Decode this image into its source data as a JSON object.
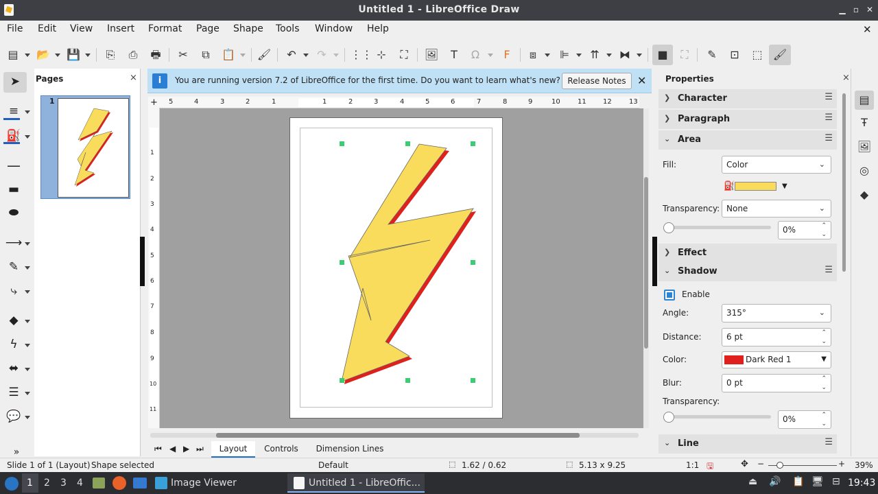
{
  "window": {
    "title": "Untitled 1 - LibreOffice Draw"
  },
  "menu": [
    "File",
    "Edit",
    "View",
    "Insert",
    "Format",
    "Page",
    "Shape",
    "Tools",
    "Window",
    "Help"
  ],
  "pages_panel": {
    "title": "Pages",
    "close": "×",
    "thumb_number": "1"
  },
  "infobar": {
    "message": "You are running version 7.2 of LibreOffice for the first time. Do you want to learn what's new?",
    "button": "Release Notes",
    "close": "✕"
  },
  "ruler_h": [
    "5",
    "4",
    "3",
    "2",
    "1",
    "1",
    "2",
    "3",
    "4",
    "5",
    "6",
    "7",
    "8",
    "9",
    "10",
    "11",
    "12",
    "13"
  ],
  "ruler_v": [
    "1",
    "2",
    "3",
    "4",
    "5",
    "6",
    "7",
    "8",
    "9",
    "10",
    "11"
  ],
  "tabs": [
    {
      "label": "Layout",
      "active": true
    },
    {
      "label": "Controls",
      "active": false
    },
    {
      "label": "Dimension Lines",
      "active": false
    }
  ],
  "properties": {
    "title": "Properties",
    "close": "×",
    "character": "Character",
    "paragraph": "Paragraph",
    "area": "Area",
    "fill_label": "Fill:",
    "fill_value": "Color",
    "fill_color": "#f9dc5c",
    "transparency_label": "Transparency:",
    "transparency_value": "None",
    "transparency_pct": "0%",
    "effect": "Effect",
    "shadow": "Shadow",
    "enable_label": "Enable",
    "enable_checked": true,
    "angle_label": "Angle:",
    "angle_value": "315°",
    "distance_label": "Distance:",
    "distance_value": "6 pt",
    "color_label": "Color:",
    "color_value": "Dark Red 1",
    "shadow_color": "#e0201c",
    "blur_label": "Blur:",
    "blur_value": "0 pt",
    "shadow_transparency_label": "Transparency:",
    "shadow_transparency_pct": "0%",
    "line": "Line"
  },
  "status": {
    "slide": "Slide 1 of 1 (Layout)",
    "selection": "Shape selected",
    "master": "Default",
    "position": "1.62 / 0.62",
    "size": "5.13 x 9.25",
    "scale": "1:1",
    "zoom": "39%",
    "zoom_minus": "−",
    "zoom_plus": "+"
  },
  "taskbar": {
    "workspaces": [
      "1",
      "2",
      "3",
      "4"
    ],
    "apps": [
      {
        "label": "Image Viewer"
      },
      {
        "label": "Untitled 1 - LibreOffic..."
      }
    ],
    "clock": "19:43"
  },
  "colors": {
    "accent": "#1e73be",
    "shape_fill": "#f9dc5c",
    "shadow": "#e0201c",
    "info": "#bfe0f5"
  }
}
